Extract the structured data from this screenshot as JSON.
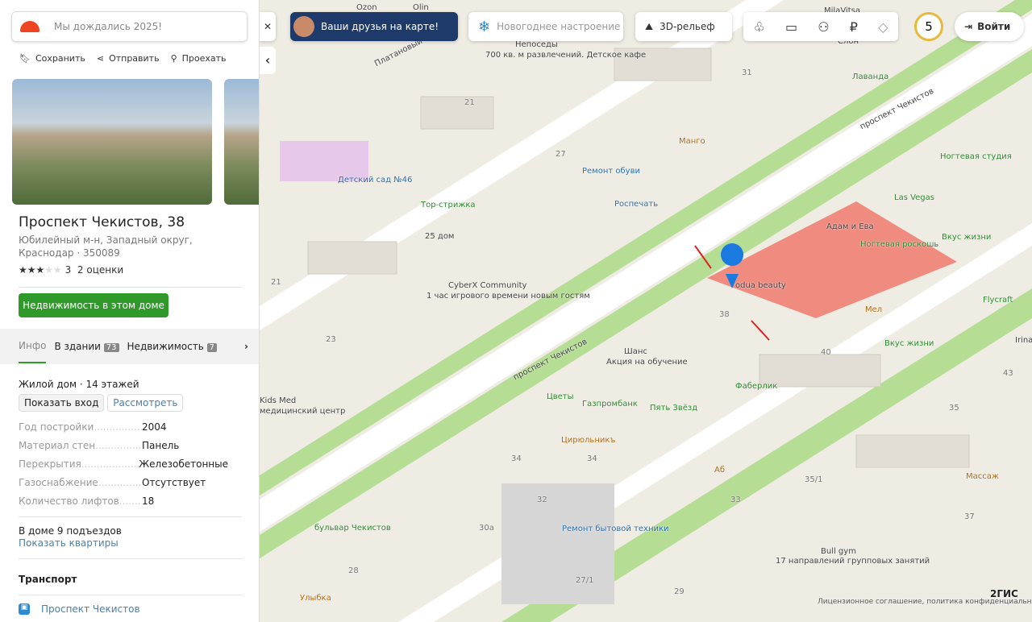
{
  "search": {
    "placeholder": "Мы дождались 2025!"
  },
  "actions": {
    "save": "Сохранить",
    "share": "Отправить",
    "route": "Проехать"
  },
  "place": {
    "title": "Проспект Чекистов, 38",
    "address_line1": "Юбилейный м-н, Западный округ,",
    "address_line2": "Краснодар · 350089",
    "rating_value": "3",
    "rating_count": "2 оценки",
    "rating_stars": 3,
    "realty_button": "Недвижимость в этом доме"
  },
  "tabs": [
    {
      "label": "Инфо"
    },
    {
      "label": "В здании",
      "count": "73"
    },
    {
      "label": "Недвижимость",
      "count": "7"
    }
  ],
  "info": {
    "type": "Жилой дом",
    "floors": "14 этажей",
    "show_entrance": "Показать вход",
    "view": "Рассмотреть",
    "props": [
      {
        "k": "Год постройки",
        "v": "2004"
      },
      {
        "k": "Материал стен",
        "v": "Панель"
      },
      {
        "k": "Перекрытия",
        "v": "Железобетонные"
      },
      {
        "k": "Газоснабжение",
        "v": "Отсутствует"
      },
      {
        "k": "Количество лифтов",
        "v": "18"
      }
    ],
    "entrances": "В доме 9 подъездов",
    "show_flats": "Показать квартиры",
    "transport_title": "Транспорт",
    "stop": "Проспект Чекистов"
  },
  "toolbar": {
    "friends": "Ваши друзья на карте!",
    "newyear": "Новогоднее настроение",
    "relief": "3D-рельеф",
    "notifications": "5",
    "login": "Войти"
  },
  "map": {
    "labels": [
      "Ozon",
      "Olin",
      "Непоседы",
      "700 кв. м развлечений. Детское кафе",
      "Слон",
      "Лаванда",
      "MilaVitsa",
      "Манго",
      "Ремонт обуви",
      "Ногтевая студия",
      "Детский сад №46",
      "Тор-стрижка",
      "Роспечать",
      "Las Vegas",
      "Адам и Ева",
      "Ногтевая роскошь",
      "Вкус жизни",
      "25 дом",
      "CyberX Community",
      "1 час игрового времени новым гостям",
      "odua beauty",
      "Мел",
      "Flycraft",
      "Irina M",
      "Вкус жизни",
      "Шанс",
      "Акция на обучение",
      "Фаберлик",
      "Kids Med",
      "медицинский центр",
      "Цветы",
      "Газпромбанк",
      "Пять Звёзд",
      "Цирюльникъ",
      "Аб",
      "Массаж",
      "бульвар Чекистов",
      "Ремонт бытовой техники",
      "Bull gym",
      "17 направлений групповых занятий",
      "Улыбка",
      "проспект Чекистов",
      "проспект Чекистов",
      "Платановый"
    ],
    "numbers": [
      "31",
      "21",
      "27",
      "21",
      "23",
      "38",
      "40",
      "43",
      "35",
      "34",
      "34",
      "32",
      "30а",
      "33",
      "35/1",
      "37",
      "28",
      "27/1",
      "29"
    ],
    "copyright": "Лицензионное соглашение, политика конфиденциальности",
    "brand": "2ГИС"
  },
  "colors": {
    "accent": "#2f9a2a",
    "selected_building": "#f07a6e",
    "marker": "#1a7ae0"
  }
}
